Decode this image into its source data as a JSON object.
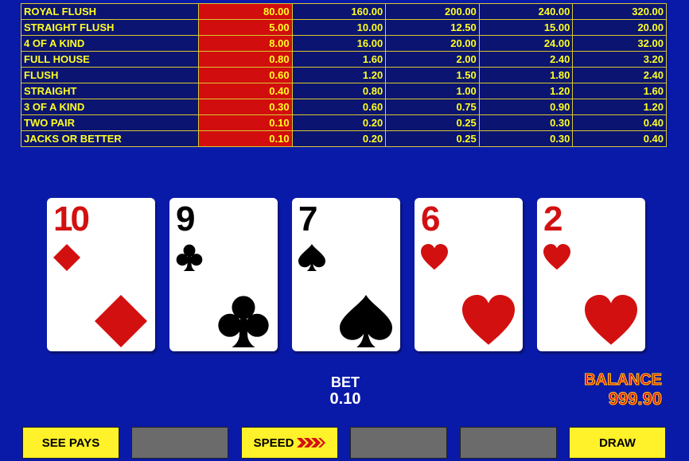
{
  "paytable": {
    "rows": [
      {
        "hand": "ROYAL FLUSH",
        "values": [
          "80.00",
          "160.00",
          "200.00",
          "240.00",
          "320.00"
        ]
      },
      {
        "hand": "STRAIGHT FLUSH",
        "values": [
          "5.00",
          "10.00",
          "12.50",
          "15.00",
          "20.00"
        ]
      },
      {
        "hand": "4 OF A KIND",
        "values": [
          "8.00",
          "16.00",
          "20.00",
          "24.00",
          "32.00"
        ]
      },
      {
        "hand": "FULL HOUSE",
        "values": [
          "0.80",
          "1.60",
          "2.00",
          "2.40",
          "3.20"
        ]
      },
      {
        "hand": "FLUSH",
        "values": [
          "0.60",
          "1.20",
          "1.50",
          "1.80",
          "2.40"
        ]
      },
      {
        "hand": "STRAIGHT",
        "values": [
          "0.40",
          "0.80",
          "1.00",
          "1.20",
          "1.60"
        ]
      },
      {
        "hand": "3 OF A KIND",
        "values": [
          "0.30",
          "0.60",
          "0.75",
          "0.90",
          "1.20"
        ]
      },
      {
        "hand": "TWO PAIR",
        "values": [
          "0.10",
          "0.20",
          "0.25",
          "0.30",
          "0.40"
        ]
      },
      {
        "hand": "JACKS OR BETTER",
        "values": [
          "0.10",
          "0.20",
          "0.25",
          "0.30",
          "0.40"
        ]
      }
    ],
    "active_column": 0,
    "colors": {
      "text": "#ffff22",
      "border": "#d9c832",
      "active": "#d10d0d"
    }
  },
  "cards": [
    {
      "rank": "10",
      "suit": "diamond",
      "color": "red"
    },
    {
      "rank": "9",
      "suit": "club",
      "color": "black"
    },
    {
      "rank": "7",
      "suit": "spade",
      "color": "black"
    },
    {
      "rank": "6",
      "suit": "heart",
      "color": "red"
    },
    {
      "rank": "2",
      "suit": "heart",
      "color": "red"
    }
  ],
  "bet": {
    "label": "BET",
    "value": "0.10"
  },
  "balance": {
    "label": "BALANCE",
    "value": "999.90"
  },
  "buttons": {
    "see_pays": "SEE PAYS",
    "speed": "SPEED",
    "draw": "DRAW"
  },
  "colors": {
    "background": "#0a1aa8",
    "button_yellow": "#fff12a",
    "button_gray": "#6b6b6b"
  }
}
